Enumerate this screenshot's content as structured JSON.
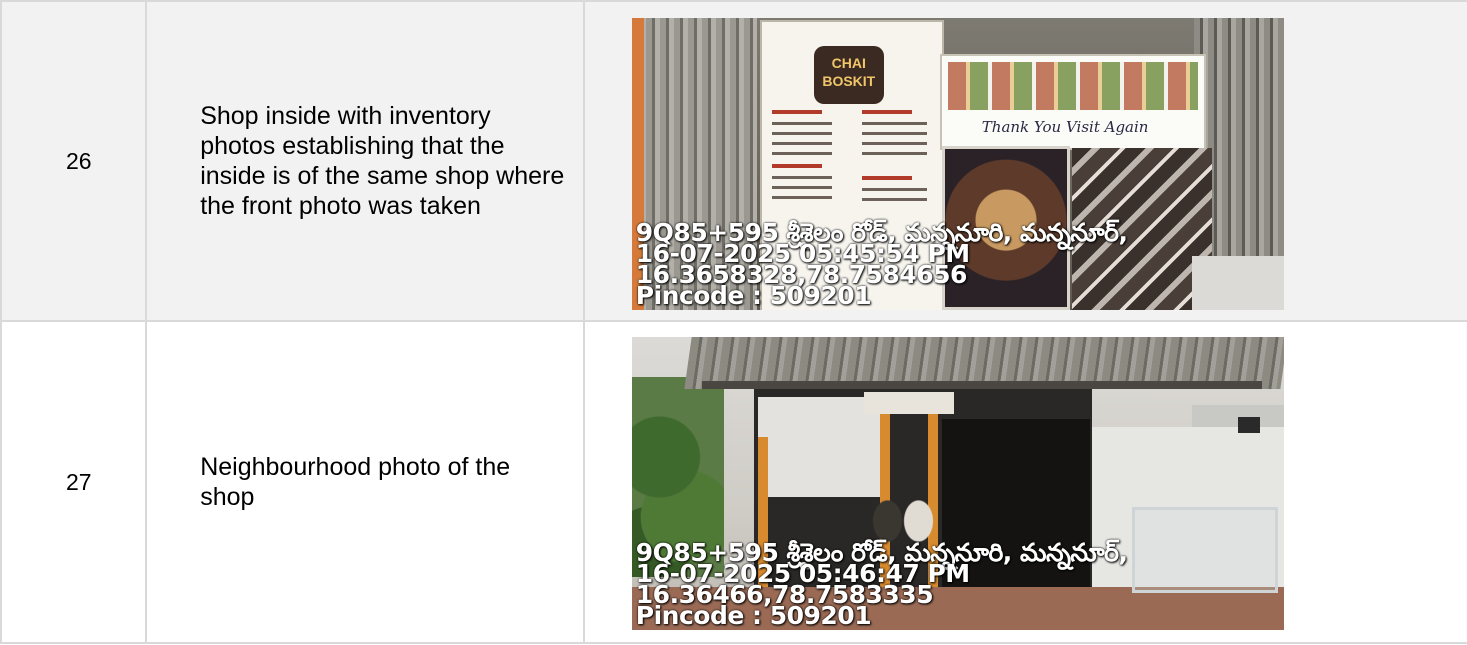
{
  "rows": [
    {
      "number": "26",
      "description": "Shop inside with inventory photos establishing that the inside is of the same shop where the front photo was taken",
      "photo": {
        "subject": "shop-interior",
        "geotag": {
          "address": "9Q85+595 శ్రీశైలం రోడ్, మన్ననూరి, మన్ననూర్,",
          "datetime": "16-07-2025 05:45:54 PM",
          "coordinates": "16.3658328,78.7584656",
          "pincode": "Pincode : 509201"
        },
        "signage": {
          "thanks": "Thank You Visit Again"
        }
      }
    },
    {
      "number": "27",
      "description": "Neighbourhood photo of the shop",
      "photo": {
        "subject": "shop-exterior",
        "geotag": {
          "address": "9Q85+595 శ్రీశైలం రోడ్, మన్ననూరి, మన్ననూర్,",
          "datetime": "16-07-2025 05:46:47 PM",
          "coordinates": "16.36466,78.7583335",
          "pincode": "Pincode : 509201"
        }
      }
    }
  ]
}
